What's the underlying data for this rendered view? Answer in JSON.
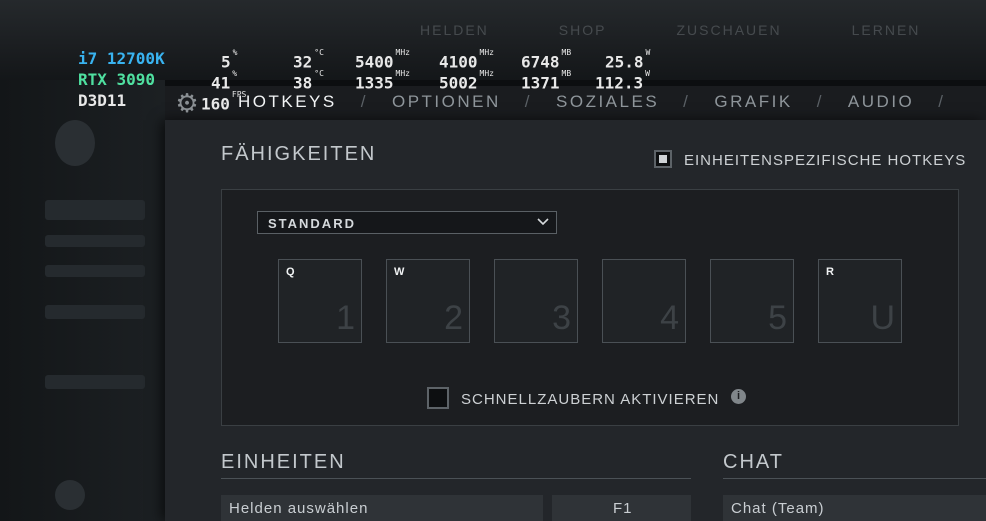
{
  "background_nav": [
    "HELDEN",
    "SHOP",
    "ZUSCHAUEN",
    "LERNEN"
  ],
  "osd": {
    "rows": [
      {
        "label": "i7 12700K",
        "label_color": "#39b3f0",
        "usage": "5",
        "usage_unit": "%",
        "temp": "32",
        "temp_unit": "°C",
        "clock1": "5400",
        "clock1_unit": "MHz",
        "clock2": "4100",
        "clock2_unit": "MHz",
        "mem": "6748",
        "mem_unit": "MB",
        "power": "25.8",
        "power_unit": "W"
      },
      {
        "label": "RTX 3090",
        "label_color": "#4fe0a0",
        "usage": "41",
        "usage_unit": "%",
        "temp": "38",
        "temp_unit": "°C",
        "clock1": "1335",
        "clock1_unit": "MHz",
        "clock2": "5002",
        "clock2_unit": "MHz",
        "mem": "1371",
        "mem_unit": "MB",
        "power": "112.3",
        "power_unit": "W"
      },
      {
        "label": "D3D11",
        "label_color": "#e8e8e8",
        "fps": "160",
        "fps_unit": "FPS"
      }
    ]
  },
  "tabs": [
    {
      "label": "HOTKEYS",
      "active": true
    },
    {
      "label": "OPTIONEN",
      "active": false
    },
    {
      "label": "SOZIALES",
      "active": false
    },
    {
      "label": "GRAFIK",
      "active": false
    },
    {
      "label": "AUDIO",
      "active": false
    }
  ],
  "tab_separator": "/",
  "abilities": {
    "title": "FÄHIGKEITEN",
    "unit_specific_hotkeys": {
      "label": "EINHEITENSPEZIFISCHE HOTKEYS",
      "checked": true
    },
    "preset": {
      "value": "STANDARD"
    },
    "slots": [
      {
        "hotkey": "Q",
        "number": "1"
      },
      {
        "hotkey": "W",
        "number": "2"
      },
      {
        "hotkey": "",
        "number": "3"
      },
      {
        "hotkey": "",
        "number": "4"
      },
      {
        "hotkey": "",
        "number": "5"
      },
      {
        "hotkey": "R",
        "number": "U"
      }
    ],
    "quickcast": {
      "label": "SCHNELLZAUBERN AKTIVIEREN",
      "checked": false
    },
    "info_icon": "i"
  },
  "units": {
    "title": "EINHEITEN",
    "first_row": {
      "label": "Helden auswählen",
      "key": "F1"
    }
  },
  "chat": {
    "title": "CHAT",
    "first_row": {
      "label": "Chat (Team)"
    }
  }
}
